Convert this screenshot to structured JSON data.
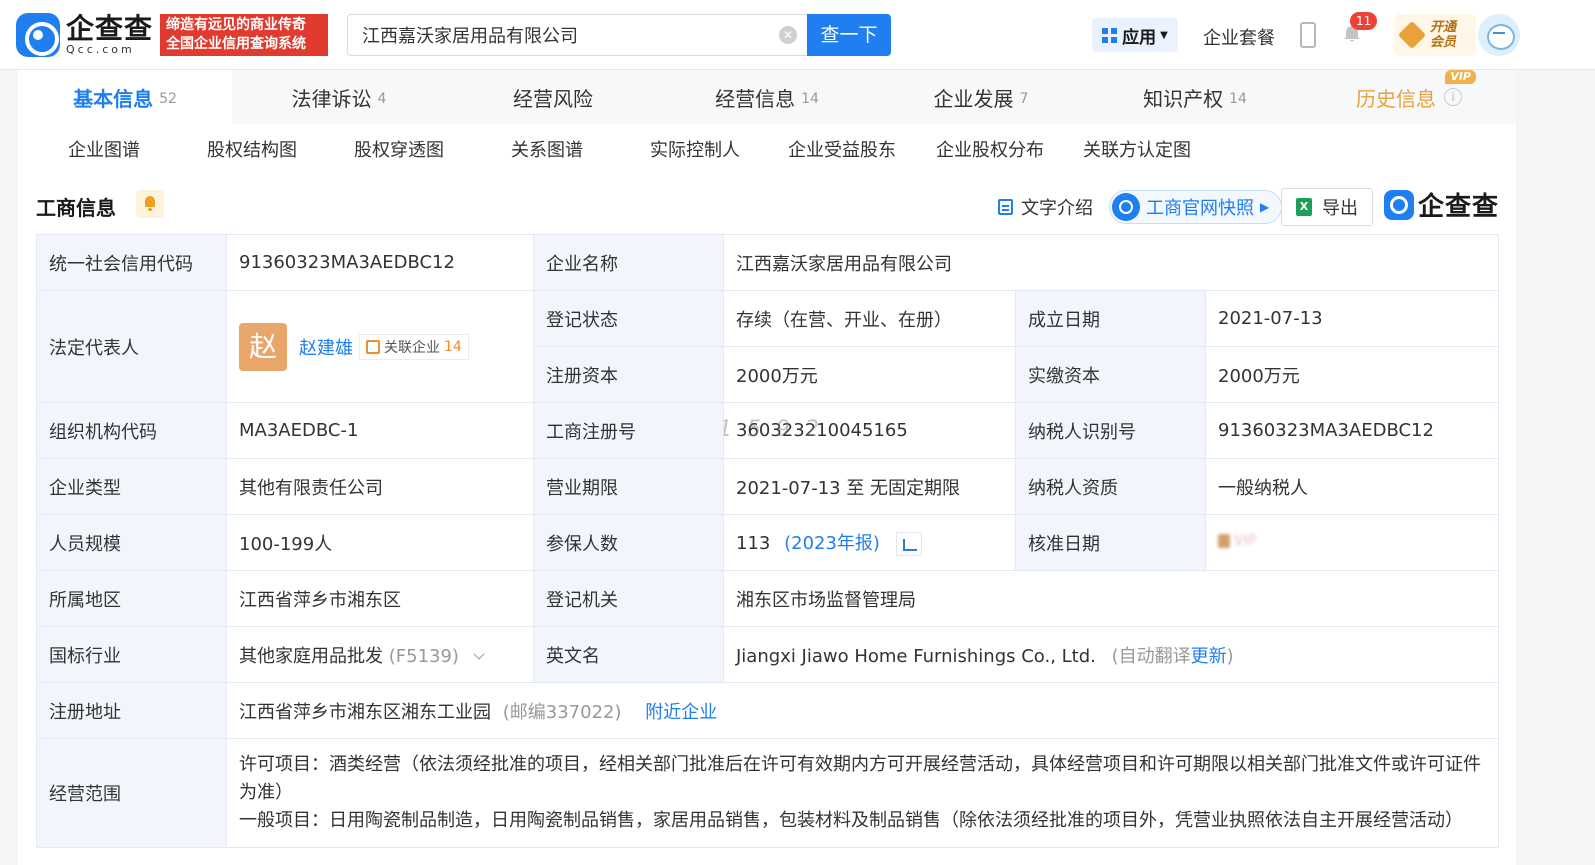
{
  "header": {
    "logo_cn": "企查查",
    "logo_en": "Qcc.com",
    "slogan_line1": "缔造有远见的商业传奇",
    "slogan_line2": "全国企业信用查询系统",
    "search_value": "江西嘉沃家居用品有限公司",
    "search_button": "查一下",
    "app_label": "应用",
    "package_label": "企业套餐",
    "notification_count": "11",
    "vip_line1": "开通",
    "vip_line2": "会员"
  },
  "tabs": [
    {
      "label": "基本信息",
      "count": "52"
    },
    {
      "label": "法律诉讼",
      "count": "4"
    },
    {
      "label": "经营风险",
      "count": ""
    },
    {
      "label": "经营信息",
      "count": "14"
    },
    {
      "label": "企业发展",
      "count": "7"
    },
    {
      "label": "知识产权",
      "count": "14"
    },
    {
      "label": "历史信息",
      "count": "",
      "tag": "VIP"
    }
  ],
  "subtabs": [
    "企业图谱",
    "股权结构图",
    "股权穿透图",
    "关系图谱",
    "实际控制人",
    "企业受益股东",
    "企业股权分布",
    "关联方认定图"
  ],
  "section": {
    "title": "工商信息",
    "text_intro": "文字介绍",
    "snapshot": "工商官网快照",
    "export": "导出",
    "brand": "企查查"
  },
  "info": {
    "credit_code_label": "统一社会信用代码",
    "credit_code": "91360323MA3AEDBC12",
    "company_name_label": "企业名称",
    "company_name": "江西嘉沃家居用品有限公司",
    "legal_rep_label": "法定代表人",
    "legal_rep_avatar": "赵",
    "legal_rep_name": "赵建雄",
    "related_label": "关联企业",
    "related_count": "14",
    "reg_status_label": "登记状态",
    "reg_status": "存续（在营、开业、在册）",
    "founded_label": "成立日期",
    "founded": "2021-07-13",
    "reg_capital_label": "注册资本",
    "reg_capital": "2000万元",
    "paid_capital_label": "实缴资本",
    "paid_capital": "2000万元",
    "org_code_label": "组织机构代码",
    "org_code": "MA3AEDBC-1",
    "reg_no_label": "工商注册号",
    "reg_no": "360323210045165",
    "watermark": "1 5 9 2",
    "taxpayer_id_label": "纳税人识别号",
    "taxpayer_id": "91360323MA3AEDBC12",
    "company_type_label": "企业类型",
    "company_type": "其他有限责任公司",
    "business_term_label": "营业期限",
    "business_term": "2021-07-13 至 无固定期限",
    "taxpayer_qual_label": "纳税人资质",
    "taxpayer_qual": "一般纳税人",
    "staff_size_label": "人员规模",
    "staff_size": "100-199人",
    "insured_label": "参保人数",
    "insured": "113",
    "insured_year": "(2023年报)",
    "approval_date_label": "核准日期",
    "approval_locked": "VIP",
    "region_label": "所属地区",
    "region": "江西省萍乡市湘东区",
    "reg_authority_label": "登记机关",
    "reg_authority": "湘东区市场监督管理局",
    "industry_label": "国标行业",
    "industry": "其他家庭用品批发",
    "industry_code": "(F5139)",
    "english_name_label": "英文名",
    "english_name": "Jiangxi Jiawo Home Furnishings Co., Ltd.",
    "english_note_prefix": "(自动翻译",
    "english_note_link": "更新",
    "english_note_suffix": ")",
    "address_label": "注册地址",
    "address": "江西省萍乡市湘东区湘东工业园",
    "postcode": "(邮编337022)",
    "nearby_link": "附近企业",
    "scope_label": "经营范围",
    "scope_line1": "许可项目：酒类经营（依法须经批准的项目，经相关部门批准后在许可有效期内方可开展经营活动，具体经营项目和许可期限以相关部门批准文件或许可证件为准）",
    "scope_line2": "一般项目：日用陶瓷制品制造，日用陶瓷制品销售，家居用品销售，包装材料及制品销售（除依法须经批准的项目外，凭营业执照依法自主开展经营活动）"
  }
}
